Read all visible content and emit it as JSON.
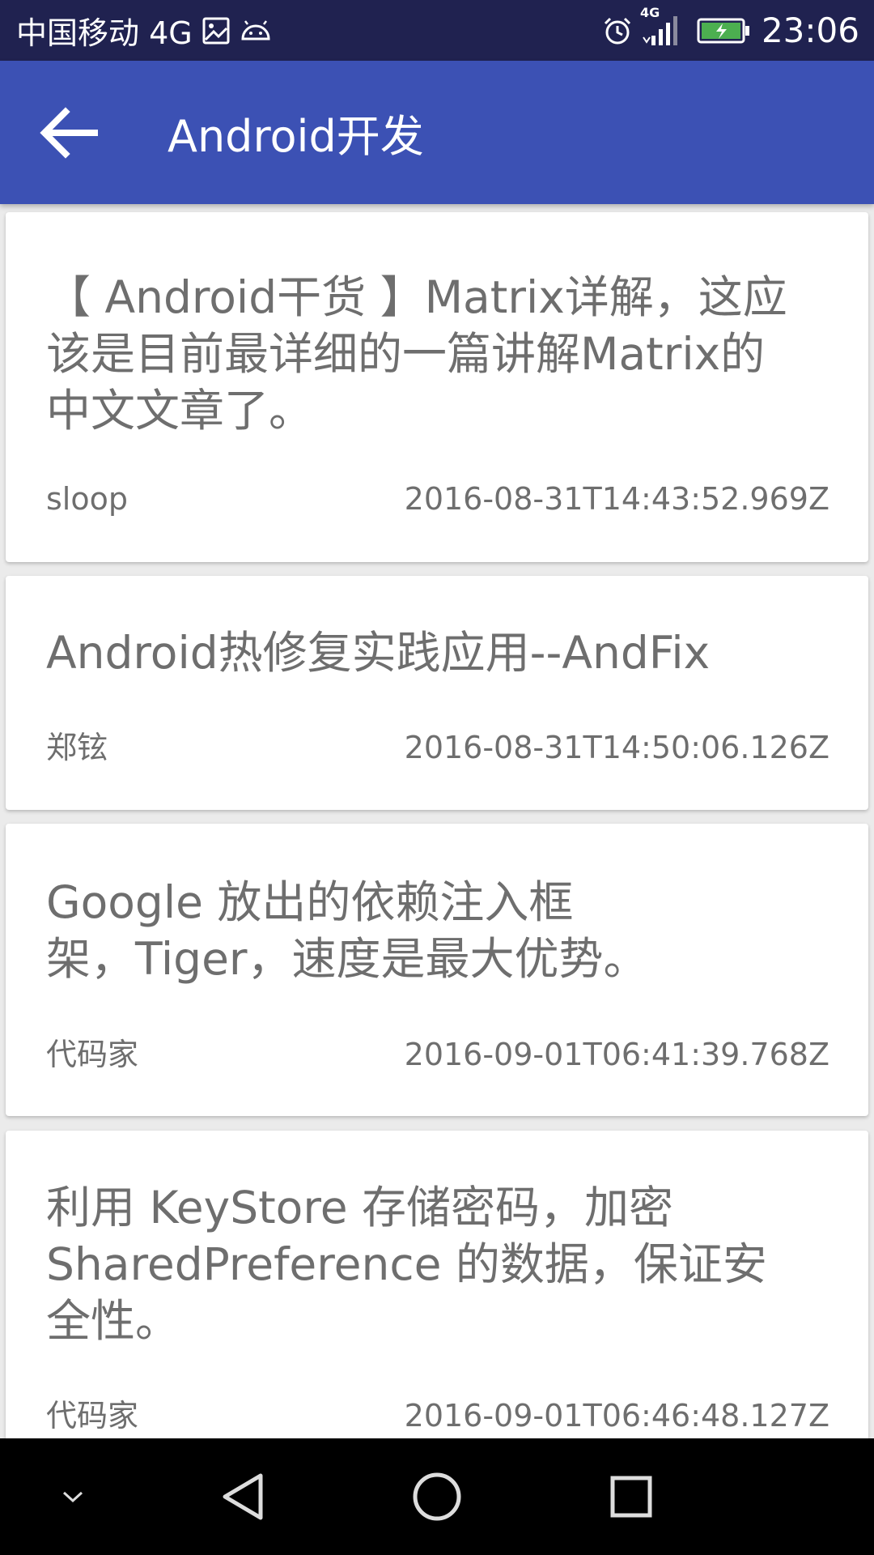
{
  "status_bar": {
    "carrier": "中国移动 4G",
    "network_small": "4G",
    "time": "23:06",
    "icons": [
      "image-icon",
      "android-icon",
      "alarm-icon",
      "signal-icon",
      "battery-charging-icon"
    ]
  },
  "app_bar": {
    "title": "Android开发",
    "back_icon": "arrow-back-icon",
    "color": "#3c51b4"
  },
  "articles": [
    {
      "title_lines": [
        "【 Android干货 】Matrix详解，这应",
        "该是目前最详细的一篇讲解Matrix的",
        "中文文章了。"
      ],
      "author": "sloop",
      "date": "2016-08-31T14:43:52.969Z"
    },
    {
      "title_lines": [
        "Android热修复实践应用--AndFix"
      ],
      "author": "郑铉",
      "date": "2016-08-31T14:50:06.126Z"
    },
    {
      "title_lines": [
        "Google 放出的依赖注入框",
        "架，Tiger，速度是最大优势。"
      ],
      "author": "代码家",
      "date": "2016-09-01T06:41:39.768Z"
    },
    {
      "title_lines": [
        "利用 KeyStore 存储密码，加密",
        "SharedPreference 的数据，保证安",
        "全性。"
      ],
      "author": "代码家",
      "date": "2016-09-01T06:46:48.127Z"
    }
  ],
  "nav_bar": {
    "icons": [
      "chevron-down-icon",
      "back-triangle-icon",
      "home-circle-icon",
      "recents-square-icon"
    ]
  }
}
